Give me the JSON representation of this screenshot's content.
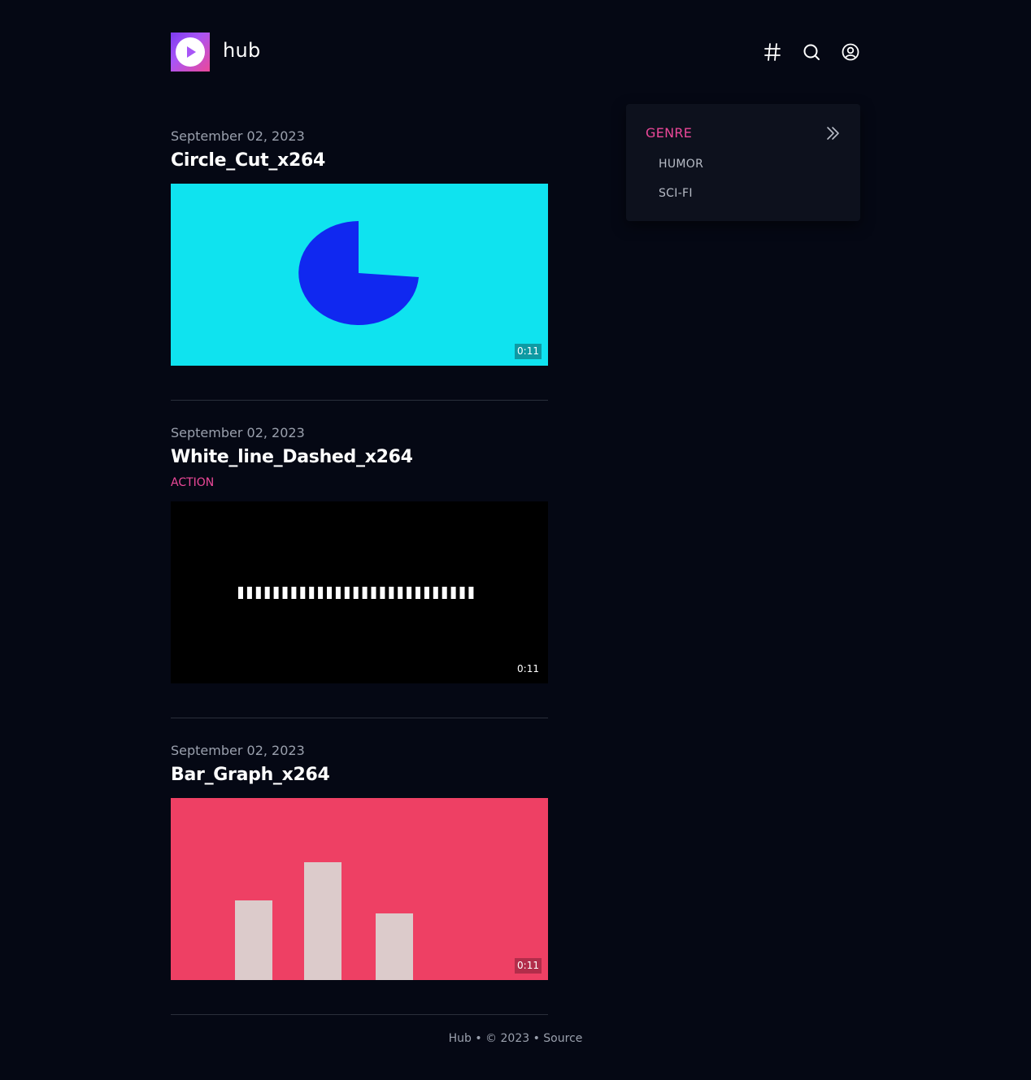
{
  "header": {
    "brand": "hub",
    "icons": [
      "play-icon",
      "hashtag-icon",
      "search-icon",
      "user-icon"
    ]
  },
  "posts": [
    {
      "date": "September 02, 2023",
      "title": "Circle_Cut_x264",
      "tag": "",
      "duration": "0:11",
      "thumb_bg": "#0fe3ef",
      "thumb_fg": "#1028f0"
    },
    {
      "date": "September 02, 2023",
      "title": "White_line_Dashed_x264",
      "tag": "ACTION",
      "duration": "0:11",
      "thumb_bg": "#000000",
      "thumb_fg": "#ffffff"
    },
    {
      "date": "September 02, 2023",
      "title": "Bar_Graph_x264",
      "tag": "",
      "duration": "0:11",
      "thumb_bg": "#ee4064",
      "thumb_fg": "#dccbcb"
    }
  ],
  "sidebar": {
    "title": "GENRE",
    "items": [
      "HUMOR",
      "SCI-FI"
    ]
  },
  "footer": {
    "text": "Hub • © 2023 • Source"
  },
  "colors": {
    "background": "#050814",
    "accent": "#ec4899",
    "panel": "#0d111d"
  }
}
